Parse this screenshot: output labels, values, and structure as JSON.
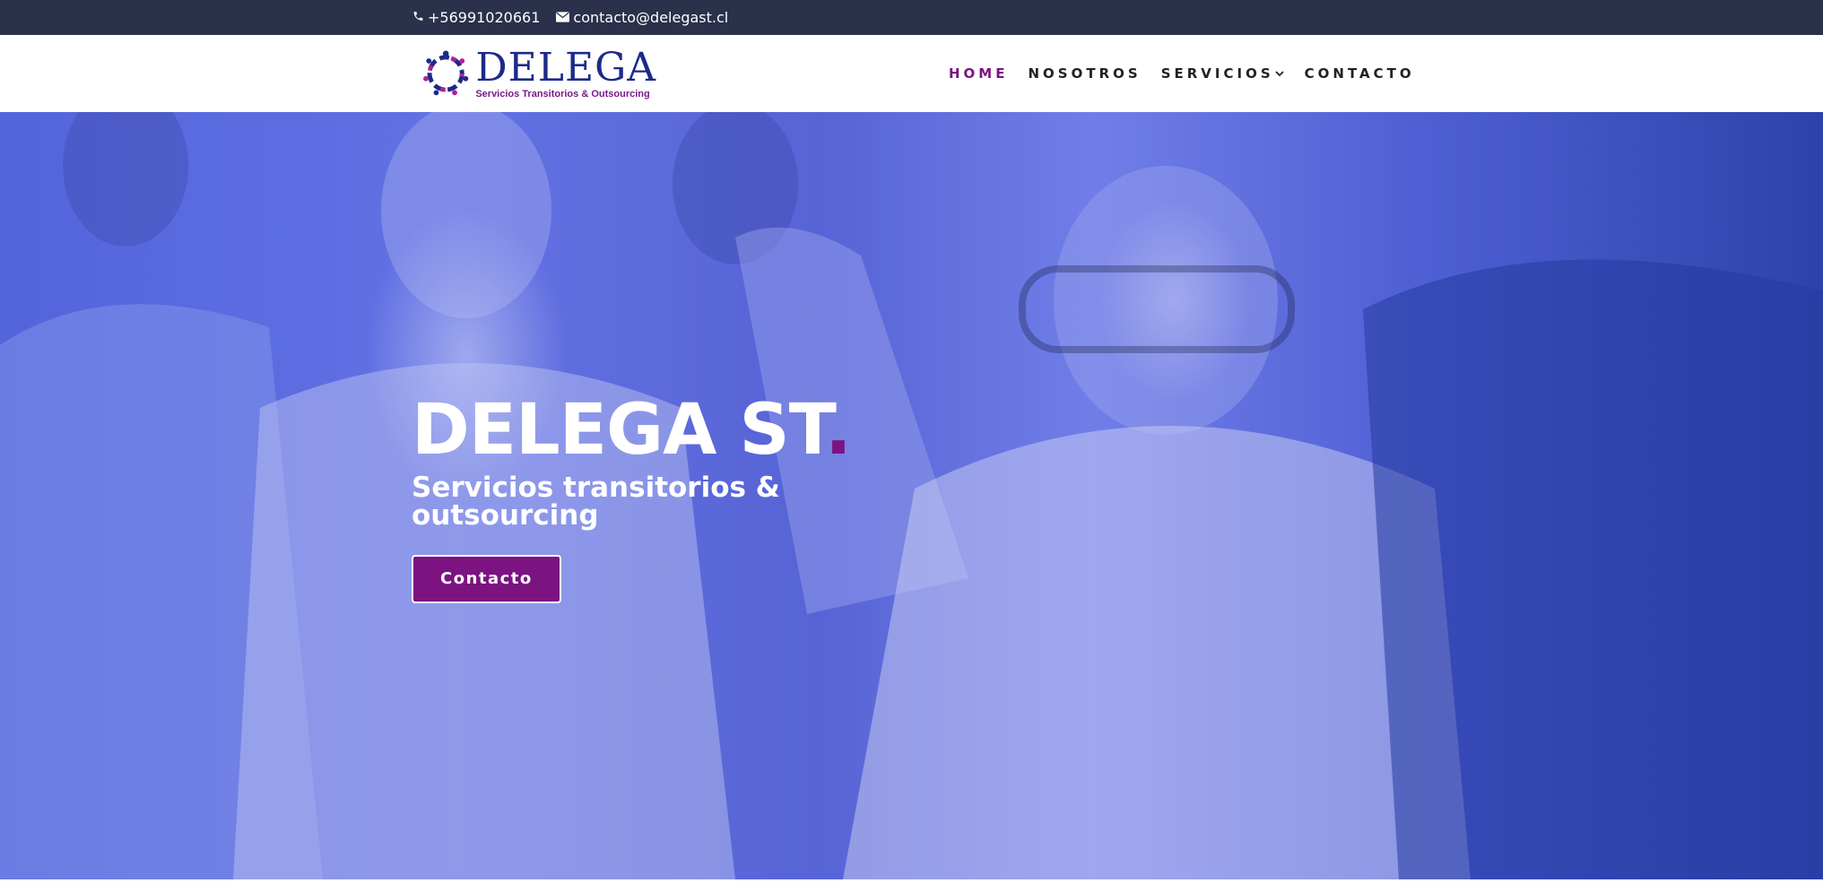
{
  "topbar": {
    "phone": "+56991020661",
    "email": "contacto@delegast.cl",
    "phone_icon": "phone-icon",
    "email_icon": "envelope-icon"
  },
  "logo": {
    "name": "DELEGA",
    "tagline": "Servicios Transitorios & Outsourcing"
  },
  "nav": {
    "items": [
      {
        "label": "HOME",
        "active": true
      },
      {
        "label": "NOSOTROS",
        "active": false
      },
      {
        "label": "SERVICIOS",
        "active": false,
        "has_dropdown": true
      },
      {
        "label": "CONTACTO",
        "active": false
      }
    ]
  },
  "hero": {
    "title": "DELEGA ST",
    "title_dot": ".",
    "subtitle": "Servicios transitorios & outsourcing",
    "button_label": "Contacto"
  },
  "colors": {
    "topbar_bg": "#2b314a",
    "accent": "#7b1481",
    "logo_blue": "#1c2a8a",
    "hero_tint": "#5a6be0"
  }
}
